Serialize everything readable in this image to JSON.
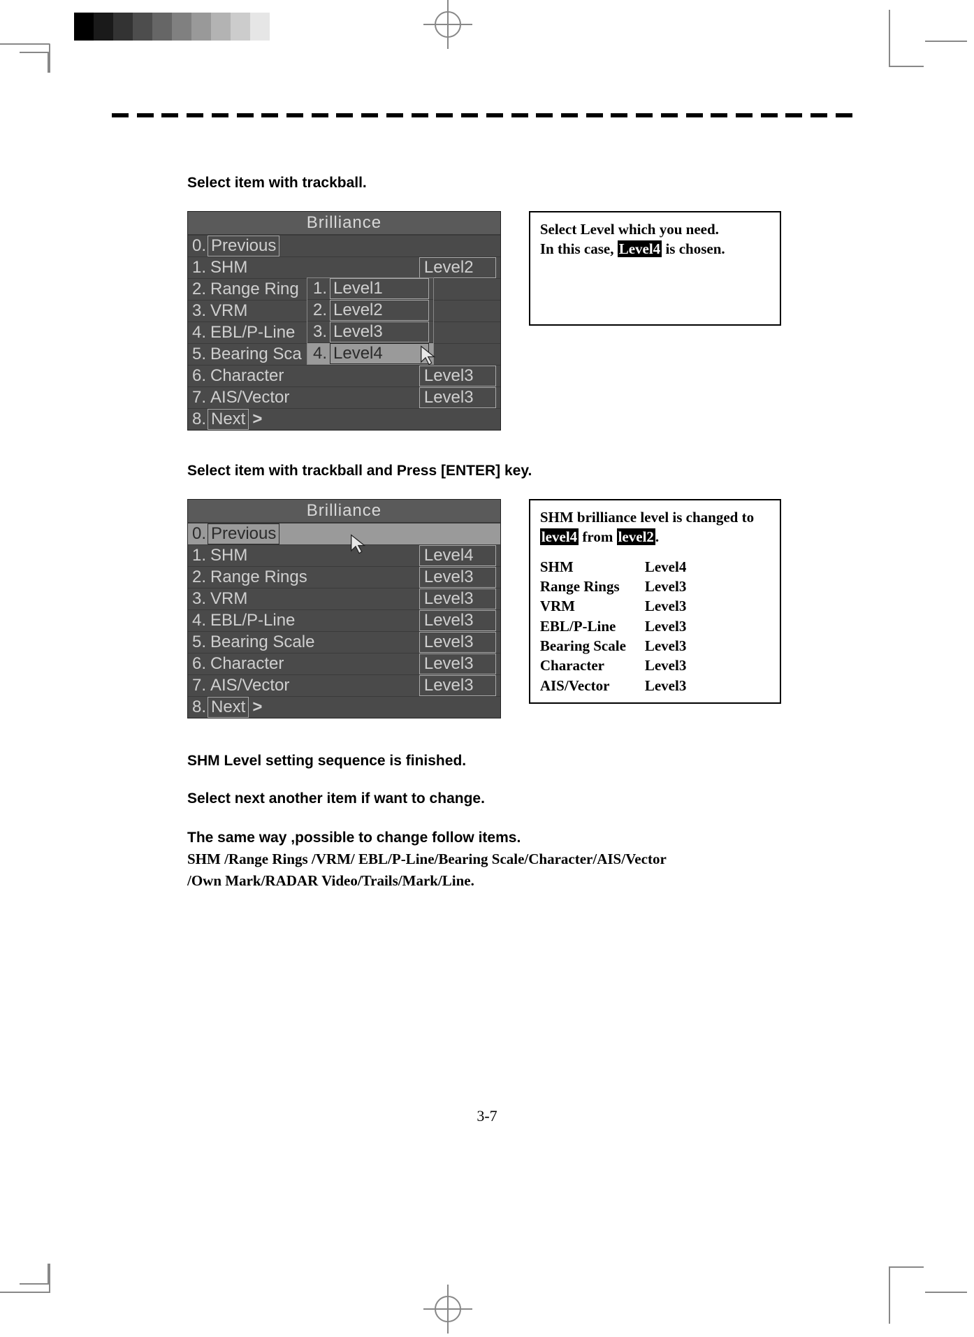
{
  "page_number": "3-7",
  "step1_caption": "Select item with trackball.",
  "step2_caption": "Select item with trackball and Press [ENTER] key.",
  "finish_line": "SHM Level setting sequence is finished.",
  "next_line": "Select next another item if want to change.",
  "sameway_line": "The same way ,possible to change follow items.",
  "items_line1": "SHM /Range Rings /VRM/ EBL/P-Line/Bearing Scale/Character/AIS/Vector",
  "items_line2": "/Own Mark/RADAR Video/Trails/Mark/Line.",
  "radar_a": {
    "title": "Brilliance",
    "rows": [
      {
        "n": "0.",
        "label": "Previous",
        "boxed": true,
        "val": "",
        "arrow": ""
      },
      {
        "n": "1.",
        "label": "SHM",
        "boxed": false,
        "val": "Level2",
        "arrow": ""
      },
      {
        "n": "2.",
        "label": "Range Rings",
        "boxed": false,
        "val": "",
        "arrow": "",
        "trunc": "Range  Ring"
      },
      {
        "n": "3.",
        "label": "VRM",
        "boxed": false,
        "val": "",
        "arrow": ""
      },
      {
        "n": "4.",
        "label": "EBL/P-Line",
        "boxed": false,
        "val": "",
        "arrow": ""
      },
      {
        "n": "5.",
        "label": "Bearing Scale",
        "boxed": false,
        "val": "",
        "arrow": "",
        "trunc": "Bearing  Sca"
      },
      {
        "n": "6.",
        "label": "Character",
        "boxed": false,
        "val": "Level3",
        "arrow": "",
        "under": "L"
      },
      {
        "n": "7.",
        "label": "AIS/Vector",
        "boxed": false,
        "val": "Level3",
        "arrow": ""
      },
      {
        "n": "8.",
        "label": "Next",
        "boxed": true,
        "val": "",
        "arrow": ">"
      }
    ],
    "submenu": [
      {
        "n": "1.",
        "label": "Level1"
      },
      {
        "n": "2.",
        "label": "Level2"
      },
      {
        "n": "3.",
        "label": "Level3"
      },
      {
        "n": "4.",
        "label": "Level4"
      }
    ],
    "submenu_selected_index": 3
  },
  "radar_b": {
    "title": "Brilliance",
    "rows": [
      {
        "n": "0.",
        "label": "Previous",
        "boxed": true,
        "val": "",
        "arrow": "",
        "selected": true
      },
      {
        "n": "1.",
        "label": "SHM",
        "boxed": false,
        "val": "Level4",
        "arrow": ""
      },
      {
        "n": "2.",
        "label": "Range  Rings",
        "boxed": false,
        "val": "Level3",
        "arrow": ""
      },
      {
        "n": "3.",
        "label": "VRM",
        "boxed": false,
        "val": "Level3",
        "arrow": ""
      },
      {
        "n": "4.",
        "label": "EBL/P-Line",
        "boxed": false,
        "val": "Level3",
        "arrow": ""
      },
      {
        "n": "5.",
        "label": "Bearing  Scale",
        "boxed": false,
        "val": "Level3",
        "arrow": ""
      },
      {
        "n": "6.",
        "label": "Character",
        "boxed": false,
        "val": "Level3",
        "arrow": ""
      },
      {
        "n": "7.",
        "label": "AIS/Vector",
        "boxed": false,
        "val": "Level3",
        "arrow": ""
      },
      {
        "n": "8.",
        "label": "Next",
        "boxed": true,
        "val": "",
        "arrow": ">"
      }
    ]
  },
  "side_a": {
    "l1": "Select Level which you need.",
    "l2a": "In this case, ",
    "l2inv": "Level4",
    "l2b": " is chosen."
  },
  "side_b": {
    "l1": "SHM brilliance level is changed to",
    "l2inv1": "level4",
    "l2mid": " from ",
    "l2inv2": "level2",
    "l2end": ".",
    "table": [
      {
        "k": "SHM",
        "v": "Level4"
      },
      {
        "k": "Range Rings",
        "v": "Level3"
      },
      {
        "k": "VRM",
        "v": "Level3"
      },
      {
        "k": "EBL/P-Line",
        "v": "Level3"
      },
      {
        "k": "Bearing Scale",
        "v": "Level3"
      },
      {
        "k": "Character",
        "v": "Level3"
      },
      {
        "k": "AIS/Vector",
        "v": "Level3"
      }
    ]
  },
  "gray_shades": [
    "#000000",
    "#1a1a1a",
    "#333333",
    "#4d4d4d",
    "#666666",
    "#808080",
    "#999999",
    "#b3b3b3",
    "#cccccc",
    "#e6e6e6"
  ]
}
